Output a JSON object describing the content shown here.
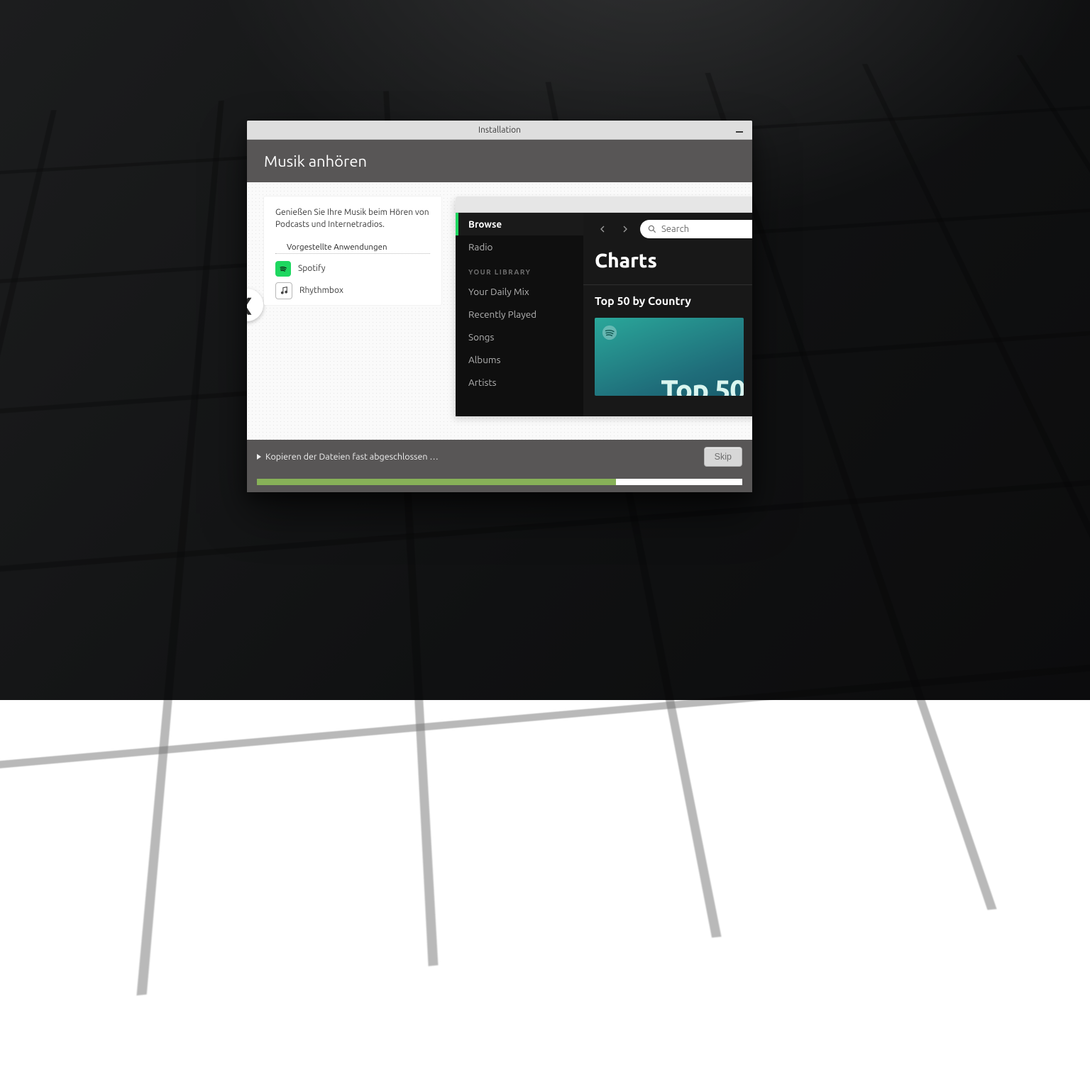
{
  "window": {
    "title": "Installation"
  },
  "slide": {
    "heading": "Musik anhören",
    "description": "Genießen Sie Ihre Musik beim Hören von Podcasts und Internetradios.",
    "apps_heading": "Vorgestellte Anwendungen",
    "apps": [
      {
        "name": "Spotify"
      },
      {
        "name": "Rhythmbox"
      }
    ]
  },
  "preview": {
    "sidebar": {
      "browse": "Browse",
      "radio": "Radio",
      "library_label": "YOUR LIBRARY",
      "items": [
        "Your Daily Mix",
        "Recently Played",
        "Songs",
        "Albums",
        "Artists"
      ]
    },
    "search_placeholder": "Search",
    "main_title": "Charts",
    "section_title": "Top 50 by Country",
    "tile_text": "Top 50"
  },
  "footer": {
    "status": "Kopieren der Dateien fast abgeschlossen …",
    "skip_label": "Skip",
    "progress_percent": 74
  },
  "colors": {
    "accent": "#87b158",
    "spotify": "#1ed760"
  }
}
